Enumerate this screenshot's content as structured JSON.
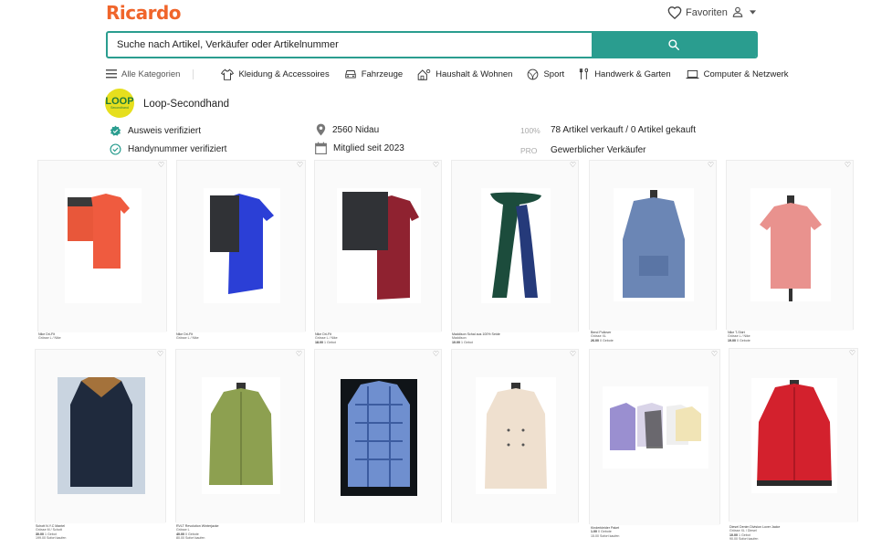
{
  "header": {
    "logo": "Ricardo",
    "favorites_label": "Favoriten"
  },
  "search": {
    "placeholder": "Suche nach Artikel, Verkäufer oder Artikelnummer"
  },
  "nav": {
    "all_categories": "Alle Kategorien",
    "categories": [
      {
        "label": "Kleidung & Accessoires",
        "icon": "shirt-icon"
      },
      {
        "label": "Fahrzeuge",
        "icon": "car-icon"
      },
      {
        "label": "Haushalt & Wohnen",
        "icon": "home-icon"
      },
      {
        "label": "Sport",
        "icon": "ball-icon"
      },
      {
        "label": "Handwerk & Garten",
        "icon": "tools-icon"
      },
      {
        "label": "Computer & Netzwerk",
        "icon": "laptop-icon"
      }
    ]
  },
  "seller": {
    "avatar_text": "LOOP",
    "avatar_subtext": "Secondhand",
    "name": "Loop-Secondhand",
    "badges": [
      {
        "label": "Ausweis verifiziert",
        "icon": "verified-badge-icon"
      },
      {
        "label": "Handynummer verifiziert",
        "icon": "check-circle-icon"
      }
    ],
    "location": "2560 Nidau",
    "member_since": "Mitglied seit 2023",
    "rating_percent": "100%",
    "sold_bought": "78 Artikel verkauft / 0 Artikel gekauft",
    "pro_label": "PRO",
    "seller_type": "Gewerblicher Verkäufer"
  },
  "colors": {
    "brand": "#f0652b",
    "accent": "#2a9d8f"
  },
  "listings": [
    {
      "title": "Nike Dri-Fit",
      "meta": "Grösse L / Nike",
      "price": "",
      "bids": "",
      "buy_now": ""
    },
    {
      "title": "Nike Dri-Fit",
      "meta": "Grösse L / Nike",
      "price": "",
      "bids": "",
      "buy_now": ""
    },
    {
      "title": "Nike Dri-Fit",
      "meta": "Grösse L / Nike",
      "price": "18.00",
      "bids": "1 Gebot",
      "buy_now": ""
    },
    {
      "title": "Maddison Schal aus 100% Seide",
      "meta": "Maddison",
      "price": "10.00",
      "bids": "1 Gebot",
      "buy_now": ""
    },
    {
      "title": "Bend Pullover",
      "meta": "Grösse XL",
      "price": "26.00",
      "bids": "0 Gebote",
      "buy_now": ""
    },
    {
      "title": "Nike T-Shirt",
      "meta": "Grösse L / Nike",
      "price": "19.00",
      "bids": "0 Gebote",
      "buy_now": ""
    },
    {
      "title": "Schott N.Y.C Mantel",
      "meta": "Grösse M / Schott",
      "price": "30.00",
      "bids": "1 Gebot",
      "buy_now": "199.00 Sofort kaufen"
    },
    {
      "title": "RVLT Revolution Winterjacke",
      "meta": "Grösse L",
      "price": "40.00",
      "bids": "0 Gebote",
      "buy_now": "80.00 Sofort kaufen"
    },
    {
      "title": "",
      "meta": "",
      "price": "",
      "bids": "",
      "buy_now": ""
    },
    {
      "title": "",
      "meta": "",
      "price": "",
      "bids": "",
      "buy_now": ""
    },
    {
      "title": "Kinderkleider Paket",
      "meta": "",
      "price": "1.00",
      "bids": "0 Gebote",
      "buy_now": "15.00 Sofort kaufen"
    },
    {
      "title": "Diesel Denim Division Lover Jacke",
      "meta": "Grösse XL / Diesel",
      "price": "10.00",
      "bids": "1 Gebot",
      "buy_now": "90.00 Sofort kaufen"
    }
  ]
}
